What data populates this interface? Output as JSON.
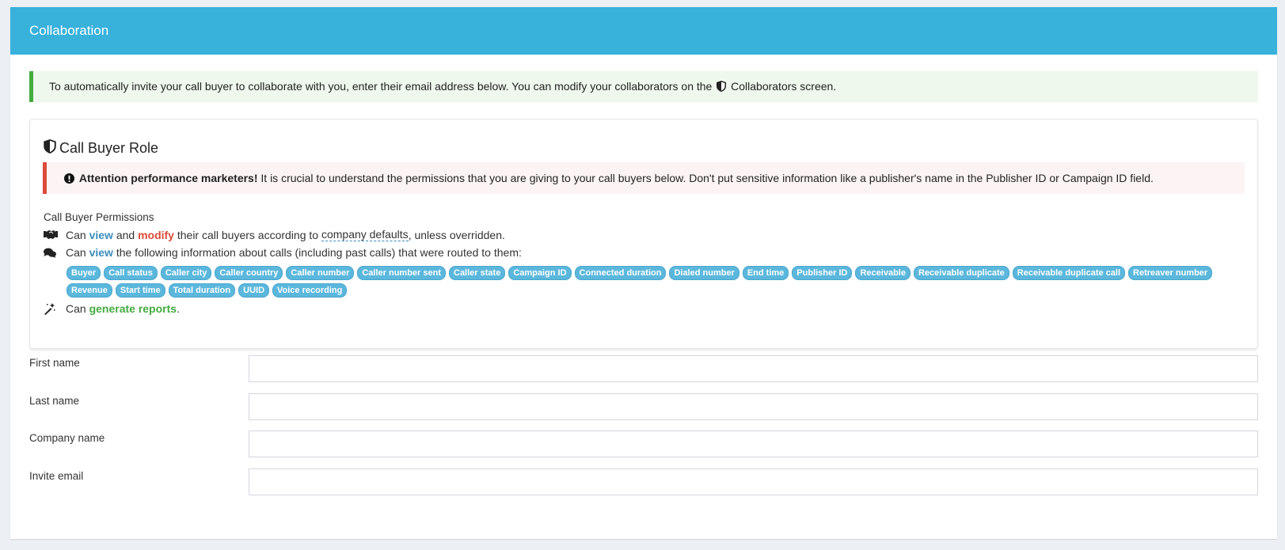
{
  "panel": {
    "title": "Collaboration"
  },
  "info": {
    "text_before": "To automatically invite your call buyer to collaborate with you, enter their email address below. You can modify your collaborators on the",
    "text_link": "Collaborators screen."
  },
  "role": {
    "title": "Call Buyer Role",
    "alert_strong": "Attention performance marketers!",
    "alert_text": "It is crucial to understand the permissions that you are giving to your call buyers below. Don't put sensitive information like a publisher's name in the Publisher ID or Campaign ID field.",
    "permissions_heading": "Call Buyer Permissions",
    "perm1": {
      "can": "Can",
      "view": "view",
      "and": "and",
      "modify": "modify",
      "mid": "their call buyers according to",
      "defaults": "company defaults",
      "end": ", unless overridden."
    },
    "perm2": {
      "can": "Can",
      "view": "view",
      "text": "the following information about calls (including past calls) that were routed to them:"
    },
    "tags": [
      "Buyer",
      "Call status",
      "Caller city",
      "Caller country",
      "Caller number",
      "Caller number sent",
      "Caller state",
      "Campaign ID",
      "Connected duration",
      "Dialed number",
      "End time",
      "Publisher ID",
      "Receivable",
      "Receivable duplicate",
      "Receivable duplicate call",
      "Retreaver number",
      "Revenue",
      "Start time",
      "Total duration",
      "UUID",
      "Voice recording"
    ],
    "perm3": {
      "can": "Can",
      "reports": "generate reports",
      "end": "."
    }
  },
  "form": {
    "first_name": {
      "label": "First name",
      "value": ""
    },
    "last_name": {
      "label": "Last name",
      "value": ""
    },
    "company_name": {
      "label": "Company name",
      "value": ""
    },
    "invite_email": {
      "label": "Invite email",
      "value": ""
    }
  },
  "colors": {
    "header": "#38b1db",
    "success": "#43ac3f",
    "danger": "#dd4b39",
    "link": "#3c8dbc",
    "tag": "#5bb7dc"
  }
}
